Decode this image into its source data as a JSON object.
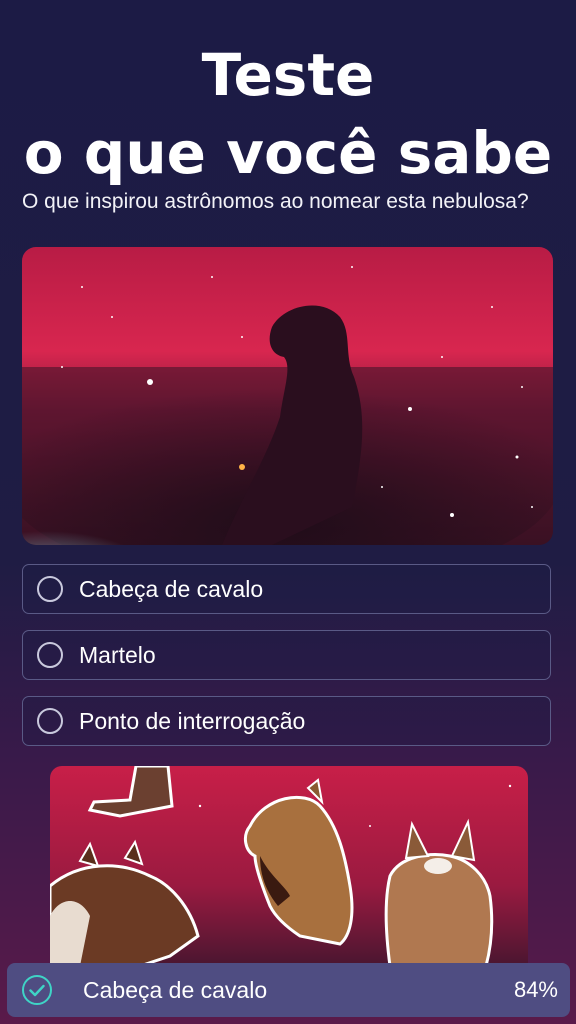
{
  "quiz": {
    "title_line1": "Teste",
    "title_line2": "o que você sabe",
    "question": "O que inspirou astrônomos ao nomear esta nebulosa?",
    "options": [
      {
        "label": "Cabeça de cavalo"
      },
      {
        "label": "Martelo"
      },
      {
        "label": "Ponto de interrogação"
      }
    ]
  },
  "result": {
    "label": "Cabeça de cavalo",
    "percent": "84%",
    "icon": "check-circle-icon"
  },
  "colors": {
    "background_top": "#1c1b45",
    "background_bottom": "#5a1a4a",
    "accent_check": "#3fd4c6",
    "result_bar": "#4f4d82",
    "nebula_red": "#d8264f"
  }
}
